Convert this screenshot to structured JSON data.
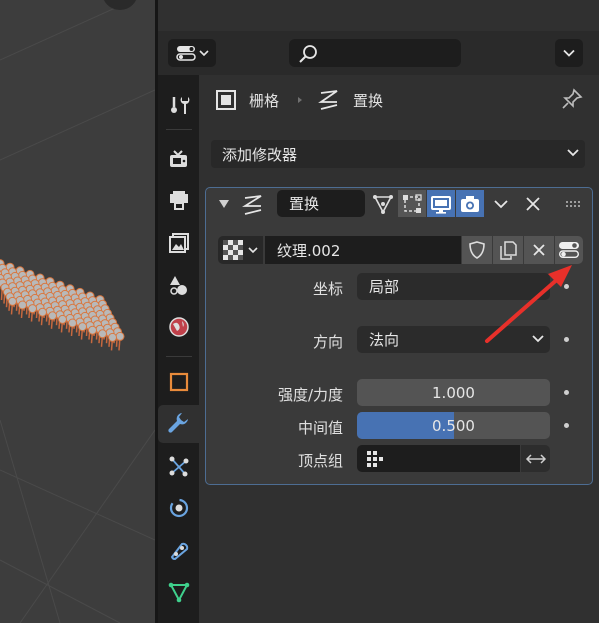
{
  "header": {
    "editor_type_icon": "properties-editor-icon",
    "search_icon": "search-icon",
    "search_value": ""
  },
  "breadcrumb": {
    "object_icon": "object-icon",
    "object_name": "栅格",
    "separator_icon": "breadcrumb-arrow-icon",
    "modifier_icon": "displace-modifier-icon",
    "modifier_name": "置换",
    "pin_icon": "pin-icon"
  },
  "tabs": [
    {
      "name": "tool",
      "icon": "tool-icon"
    },
    {
      "name": "render",
      "icon": "render-icon"
    },
    {
      "name": "output",
      "icon": "output-icon"
    },
    {
      "name": "view-layer",
      "icon": "view-layer-icon"
    },
    {
      "name": "scene",
      "icon": "scene-icon"
    },
    {
      "name": "world",
      "icon": "world-icon"
    },
    {
      "name": "object",
      "icon": "object-icon"
    },
    {
      "name": "modifiers",
      "icon": "wrench-icon",
      "active": true
    },
    {
      "name": "particles",
      "icon": "particles-icon"
    },
    {
      "name": "physics",
      "icon": "physics-icon"
    },
    {
      "name": "constraints",
      "icon": "constraints-icon"
    },
    {
      "name": "data",
      "icon": "mesh-data-icon"
    }
  ],
  "add_modifier_label": "添加修改器",
  "modifier": {
    "name": "置换",
    "header_buttons": [
      "edit-cage-icon",
      "edit-mode-icon",
      "viewport-display-icon",
      "render-icon",
      "chevron-down-icon",
      "close-icon",
      "drag-handle-icon"
    ],
    "texture": {
      "type_icon": "checker-texture-icon",
      "name": "纹理.002",
      "buttons": [
        "fake-user-shield-icon",
        "duplicate-icon",
        "close-icon",
        "toggle-icon"
      ]
    },
    "properties": {
      "coords_label": "坐标",
      "coords_value": "局部",
      "direction_label": "方向",
      "direction_value": "法向",
      "strength_label": "强度/力度",
      "strength_value": "1.000",
      "midlevel_label": "中间值",
      "midlevel_value": "0.500",
      "midlevel_fraction": 0.5,
      "vgroup_label": "顶点组",
      "vgroup_value": "",
      "vgroup_icon": "vertex-group-icon",
      "invert_icon": "invert-arrows-icon"
    }
  },
  "colors": {
    "accent_blue": "#4772b3",
    "annotation_red": "#e8302a",
    "panel_bg": "#303030",
    "outline_blue": "#4d6d93"
  }
}
